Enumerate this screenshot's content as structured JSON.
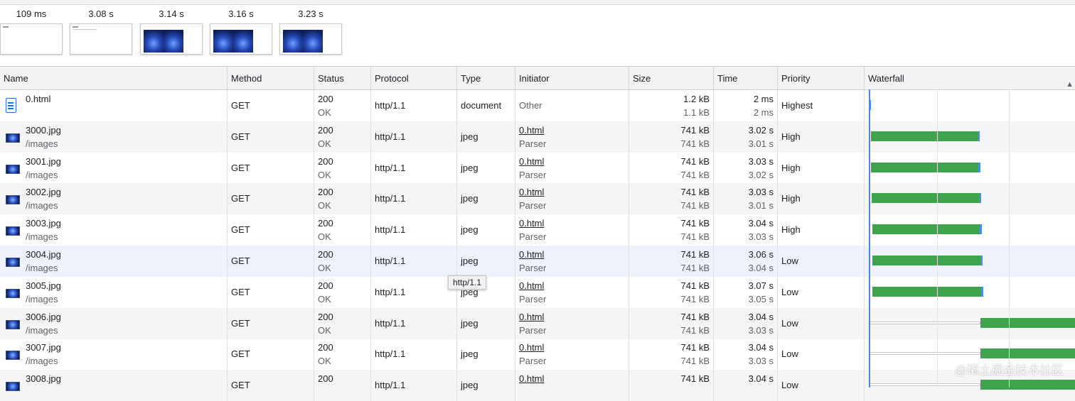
{
  "filmstrip": [
    {
      "time": "109 ms",
      "kind": "blank"
    },
    {
      "time": "3.08 s",
      "kind": "blank"
    },
    {
      "time": "3.14 s",
      "kind": "images"
    },
    {
      "time": "3.16 s",
      "kind": "images"
    },
    {
      "time": "3.23 s",
      "kind": "images"
    }
  ],
  "columns": {
    "name": "Name",
    "method": "Method",
    "status": "Status",
    "protocol": "Protocol",
    "type": "Type",
    "initiator": "Initiator",
    "size": "Size",
    "time": "Time",
    "priority": "Priority",
    "waterfall": "Waterfall"
  },
  "rows": [
    {
      "name": "0.html",
      "path": "",
      "icon": "document-icon",
      "method": "GET",
      "status": "200",
      "status_text": "OK",
      "protocol": "http/1.1",
      "type": "document",
      "initiator": "Other",
      "initiator_sub": "",
      "size": "1.2 kB",
      "size_res": "1.1 kB",
      "time": "2 ms",
      "latency": "2 ms",
      "priority": "Highest"
    },
    {
      "name": "3000.jpg",
      "path": "/images",
      "icon": "image-icon",
      "method": "GET",
      "status": "200",
      "status_text": "OK",
      "protocol": "http/1.1",
      "type": "jpeg",
      "initiator": "0.html",
      "initiator_sub": "Parser",
      "size": "741 kB",
      "size_res": "741 kB",
      "time": "3.02 s",
      "latency": "3.01 s",
      "priority": "High"
    },
    {
      "name": "3001.jpg",
      "path": "/images",
      "icon": "image-icon",
      "method": "GET",
      "status": "200",
      "status_text": "OK",
      "protocol": "http/1.1",
      "type": "jpeg",
      "initiator": "0.html",
      "initiator_sub": "Parser",
      "size": "741 kB",
      "size_res": "741 kB",
      "time": "3.03 s",
      "latency": "3.02 s",
      "priority": "High"
    },
    {
      "name": "3002.jpg",
      "path": "/images",
      "icon": "image-icon",
      "method": "GET",
      "status": "200",
      "status_text": "OK",
      "protocol": "http/1.1",
      "type": "jpeg",
      "initiator": "0.html",
      "initiator_sub": "Parser",
      "size": "741 kB",
      "size_res": "741 kB",
      "time": "3.03 s",
      "latency": "3.01 s",
      "priority": "High"
    },
    {
      "name": "3003.jpg",
      "path": "/images",
      "icon": "image-icon",
      "method": "GET",
      "status": "200",
      "status_text": "OK",
      "protocol": "http/1.1",
      "type": "jpeg",
      "initiator": "0.html",
      "initiator_sub": "Parser",
      "size": "741 kB",
      "size_res": "741 kB",
      "time": "3.04 s",
      "latency": "3.03 s",
      "priority": "High"
    },
    {
      "name": "3004.jpg",
      "path": "/images",
      "icon": "image-icon",
      "method": "GET",
      "status": "200",
      "status_text": "OK",
      "protocol": "http/1.1",
      "type": "jpeg",
      "initiator": "0.html",
      "initiator_sub": "Parser",
      "size": "741 kB",
      "size_res": "741 kB",
      "time": "3.06 s",
      "latency": "3.04 s",
      "priority": "Low"
    },
    {
      "name": "3005.jpg",
      "path": "/images",
      "icon": "image-icon",
      "method": "GET",
      "status": "200",
      "status_text": "OK",
      "protocol": "http/1.1",
      "type": "jpeg",
      "initiator": "0.html",
      "initiator_sub": "Parser",
      "size": "741 kB",
      "size_res": "741 kB",
      "time": "3.07 s",
      "latency": "3.05 s",
      "priority": "Low"
    },
    {
      "name": "3006.jpg",
      "path": "/images",
      "icon": "image-icon",
      "method": "GET",
      "status": "200",
      "status_text": "OK",
      "protocol": "http/1.1",
      "type": "jpeg",
      "initiator": "0.html",
      "initiator_sub": "Parser",
      "size": "741 kB",
      "size_res": "741 kB",
      "time": "3.04 s",
      "latency": "3.03 s",
      "priority": "Low"
    },
    {
      "name": "3007.jpg",
      "path": "/images",
      "icon": "image-icon",
      "method": "GET",
      "status": "200",
      "status_text": "OK",
      "protocol": "http/1.1",
      "type": "jpeg",
      "initiator": "0.html",
      "initiator_sub": "Parser",
      "size": "741 kB",
      "size_res": "741 kB",
      "time": "3.04 s",
      "latency": "3.03 s",
      "priority": "Low"
    },
    {
      "name": "3008.jpg",
      "path": "",
      "icon": "image-icon",
      "method": "GET",
      "status": "200",
      "status_text": "",
      "protocol": "http/1.1",
      "type": "jpeg",
      "initiator": "0.html",
      "initiator_sub": "",
      "size": "741 kB",
      "size_res": "",
      "time": "3.04 s",
      "latency": "",
      "priority": "Low"
    }
  ],
  "tooltip": "http/1.1",
  "watermark": "@稀土掘金技术社区",
  "colors": {
    "bar": "#3fa34d",
    "bar_end": "#4a90e2",
    "header_bg": "#f1f3f4",
    "alt_row": "#f5f5f5"
  }
}
